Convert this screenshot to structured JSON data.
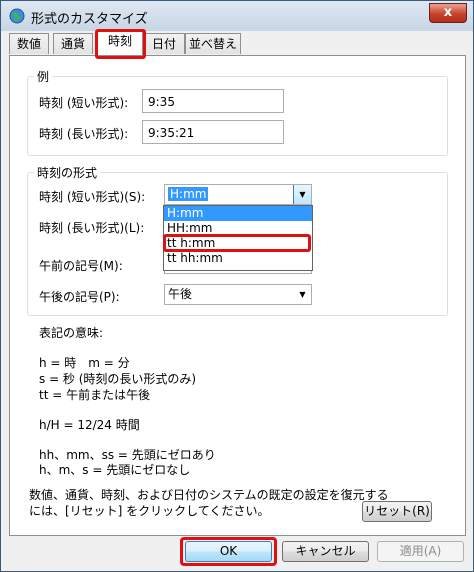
{
  "window": {
    "title": "形式のカスタマイズ",
    "close_label": "x"
  },
  "tabs": [
    "数値",
    "通貨",
    "時刻",
    "日付",
    "並べ替え"
  ],
  "example": {
    "legend": "例",
    "short_label": "時刻 (短い形式):",
    "short_value": "9:35",
    "long_label": "時刻 (長い形式):",
    "long_value": "9:35:21"
  },
  "formats": {
    "legend": "時刻の形式",
    "short_label": "時刻 (短い形式)(S):",
    "short_value": "H:mm",
    "long_label": "時刻 (長い形式)(L):",
    "am_label": "午前の記号(M):",
    "pm_label": "午後の記号(P):",
    "pm_value": "午後",
    "dropdown_options": [
      "H:mm",
      "HH:mm",
      "tt h:mm",
      "tt hh:mm"
    ]
  },
  "meaning": {
    "heading": "表記の意味:",
    "line1": "h = 時　m = 分",
    "line2": "s = 秒 (時刻の長い形式のみ)",
    "line3": "tt = 午前または午後",
    "line4": "h/H = 12/24 時間",
    "line5": "hh、mm、ss = 先頭にゼロあり",
    "line6": "h、m、s = 先頭にゼロなし"
  },
  "reset_note": {
    "line1": "数値、通貨、時刻、および日付のシステムの既定の設定を復元する",
    "line2": "には、[リセット] をクリックしてください。"
  },
  "buttons": {
    "reset": "リセット(R)",
    "ok": "OK",
    "cancel": "キャンセル",
    "apply": "適用(A)"
  }
}
